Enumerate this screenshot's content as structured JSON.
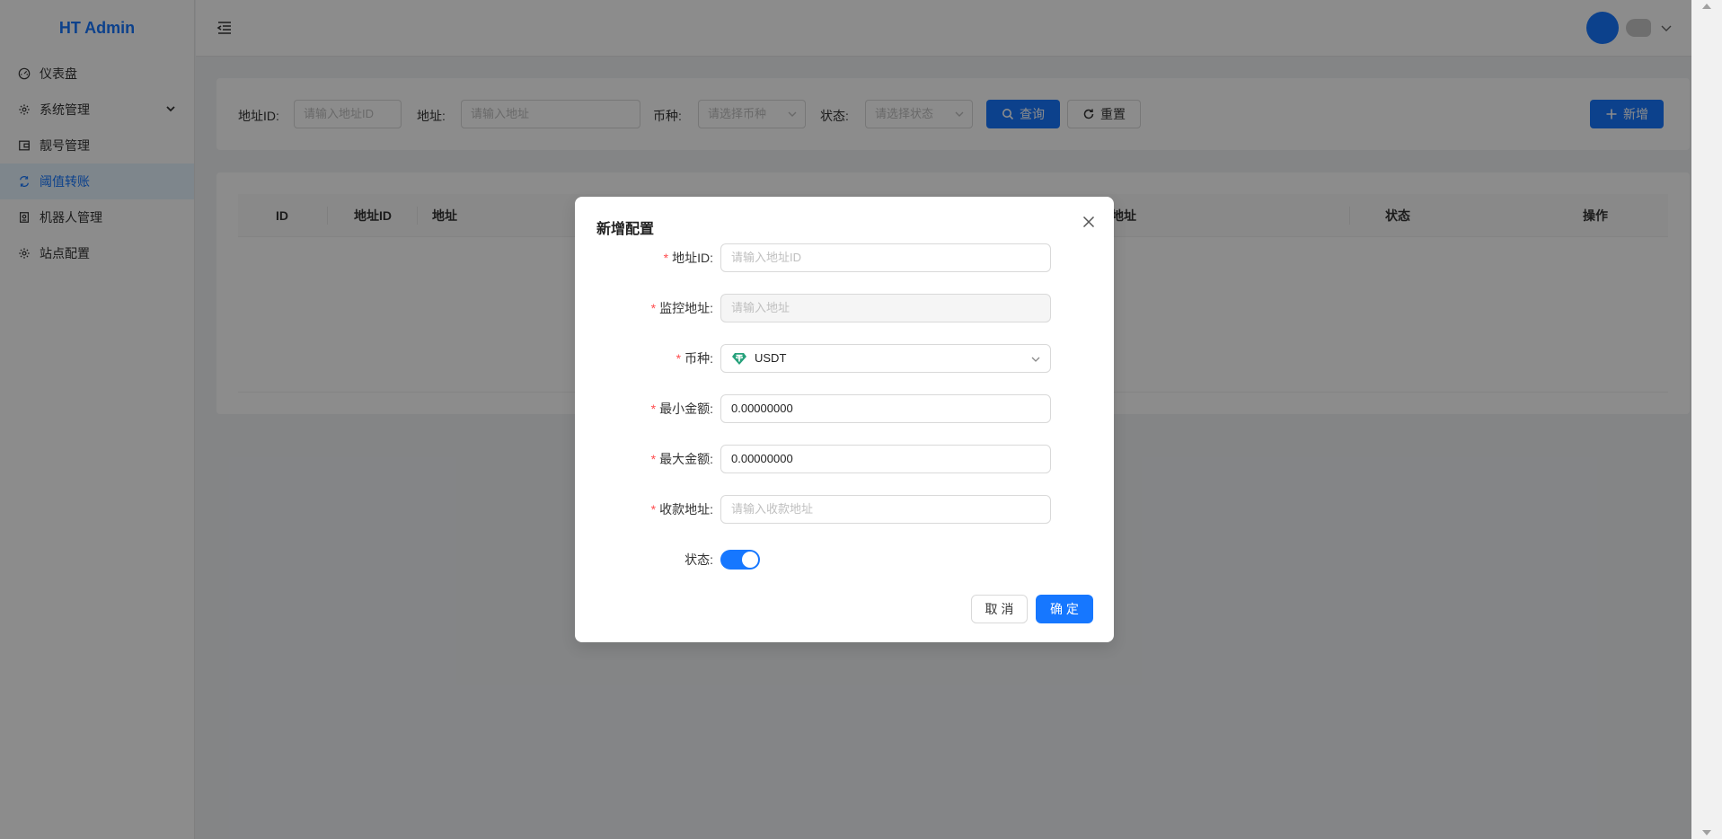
{
  "app": {
    "title": "HT Admin"
  },
  "sidebar": {
    "items": [
      {
        "label": "仪表盘",
        "icon": "dashboard-icon"
      },
      {
        "label": "系统管理",
        "icon": "gear-icon"
      },
      {
        "label": "靓号管理",
        "icon": "wallet-icon"
      },
      {
        "label": "阈值转账",
        "icon": "transfer-icon"
      },
      {
        "label": "机器人管理",
        "icon": "robot-icon"
      },
      {
        "label": "站点配置",
        "icon": "gear-icon"
      }
    ],
    "active_index": 3
  },
  "filters": {
    "address_id_label": "地址ID:",
    "address_id_placeholder": "请输入地址ID",
    "address_label": "地址:",
    "address_placeholder": "请输入地址",
    "coin_label": "币种:",
    "coin_placeholder": "请选择币种",
    "status_label": "状态:",
    "status_placeholder": "请选择状态",
    "query_button": "查询",
    "reset_button": "重置",
    "add_button": "新增"
  },
  "table": {
    "columns": [
      "ID",
      "地址ID",
      "地址",
      "地址",
      "状态",
      "操作"
    ]
  },
  "modal": {
    "title": "新增配置",
    "fields": {
      "address_id": {
        "label": "地址ID:",
        "placeholder": "请输入地址ID"
      },
      "monitor_address": {
        "label": "监控地址:",
        "placeholder": "请输入地址"
      },
      "coin": {
        "label": "币种:",
        "value": "USDT"
      },
      "min_amount": {
        "label": "最小金额:",
        "value": "0.00000000"
      },
      "max_amount": {
        "label": "最大金额:",
        "value": "0.00000000"
      },
      "receive_address": {
        "label": "收款地址:",
        "placeholder": "请输入收款地址"
      },
      "status": {
        "label": "状态:",
        "enabled": true
      }
    },
    "cancel_button": "取 消",
    "confirm_button": "确 定",
    "required_mark": "*"
  },
  "colors": {
    "primary": "#1677ff",
    "required": "#ff4d4f",
    "usdt": "#26a17b"
  }
}
